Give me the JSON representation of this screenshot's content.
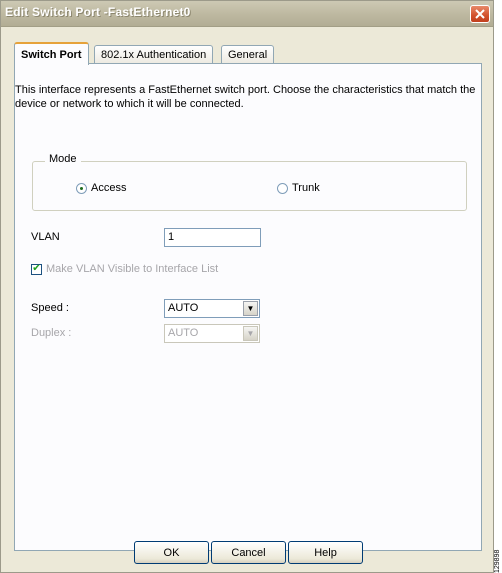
{
  "window": {
    "title": "Edit Switch Port -FastEthernet0"
  },
  "tabs": [
    {
      "label": "Switch Port"
    },
    {
      "label": "802.1x Authentication"
    },
    {
      "label": "General"
    }
  ],
  "description": "This interface represents a FastEthernet switch port. Choose the characteristics that match the device or network to which it will be connected.",
  "mode": {
    "legend": "Mode",
    "options": [
      {
        "label": "Access",
        "selected": true
      },
      {
        "label": "Trunk",
        "selected": false
      }
    ]
  },
  "vlan": {
    "label": "VLAN",
    "value": "1"
  },
  "visible_checkbox": {
    "label": "Make VLAN Visible to Interface List",
    "checked": true,
    "enabled": false
  },
  "speed": {
    "label": "Speed :",
    "value": "AUTO",
    "enabled": true
  },
  "duplex": {
    "label": "Duplex :",
    "value": "AUTO",
    "enabled": false
  },
  "buttons": {
    "ok": "OK",
    "cancel": "Cancel",
    "help": "Help"
  },
  "side_stamp": "129898"
}
